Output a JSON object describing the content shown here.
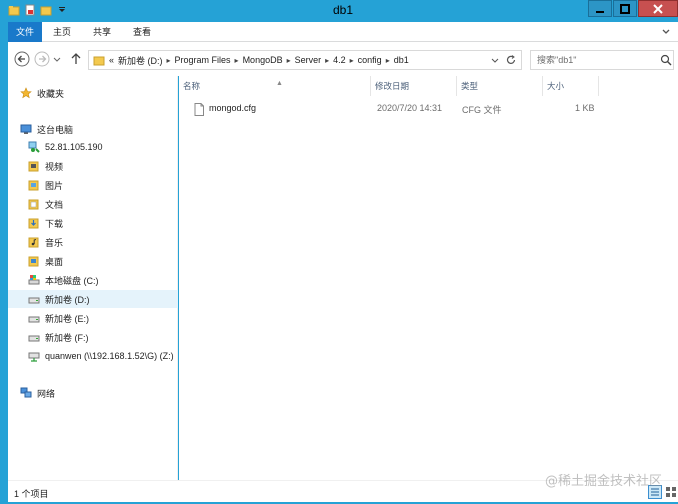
{
  "window": {
    "title": "db1"
  },
  "ribbon": {
    "tabs": [
      "文件",
      "主页",
      "共享",
      "查看"
    ]
  },
  "address": {
    "breadcrumbs": [
      "«",
      "新加卷 (D:)",
      "Program Files",
      "MongoDB",
      "Server",
      "4.2",
      "config",
      "db1"
    ]
  },
  "search": {
    "placeholder": "搜索\"db1\""
  },
  "sidebar": {
    "favorites": "收藏夹",
    "this_pc": "这台电脑",
    "items": [
      "52.81.105.190",
      "视频",
      "图片",
      "文档",
      "下载",
      "音乐",
      "桌面",
      "本地磁盘 (C:)",
      "新加卷 (D:)",
      "新加卷 (E:)",
      "新加卷 (F:)",
      "quanwen (\\\\192.168.1.52\\G) (Z:)"
    ],
    "network": "网络"
  },
  "columns": {
    "name": "名称",
    "date": "修改日期",
    "type": "类型",
    "size": "大小"
  },
  "files": [
    {
      "name": "mongod.cfg",
      "date": "2020/7/20 14:31",
      "type": "CFG 文件",
      "size": "1 KB"
    }
  ],
  "status": {
    "count": "1 个项目"
  },
  "watermark": "@稀土掘金技术社区",
  "colors": {
    "titlebar": "#25a2d6",
    "file_tab": "#1979ca",
    "selected": "#e5f3fb"
  }
}
